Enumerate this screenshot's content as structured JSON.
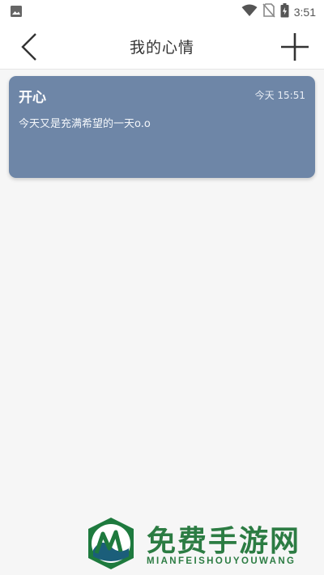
{
  "status_bar": {
    "time": "3:51",
    "icons": [
      "image-icon",
      "wifi-icon",
      "no-sim-icon",
      "battery-charging-icon"
    ]
  },
  "header": {
    "title": "我的心情",
    "back_icon": "chevron-left-icon",
    "add_icon": "plus-icon"
  },
  "entries": [
    {
      "mood": "开心",
      "time": "今天 15:51",
      "content": "今天又是充满希望的一天o.o"
    }
  ],
  "colors": {
    "card": "#6e86a7",
    "app_bar": "#ffffff",
    "background": "#f6f6f6",
    "watermark": "#2c7c43"
  },
  "watermark": {
    "title": "免费手游网",
    "subtitle": "MIANFEISHOUYOUWANG"
  }
}
